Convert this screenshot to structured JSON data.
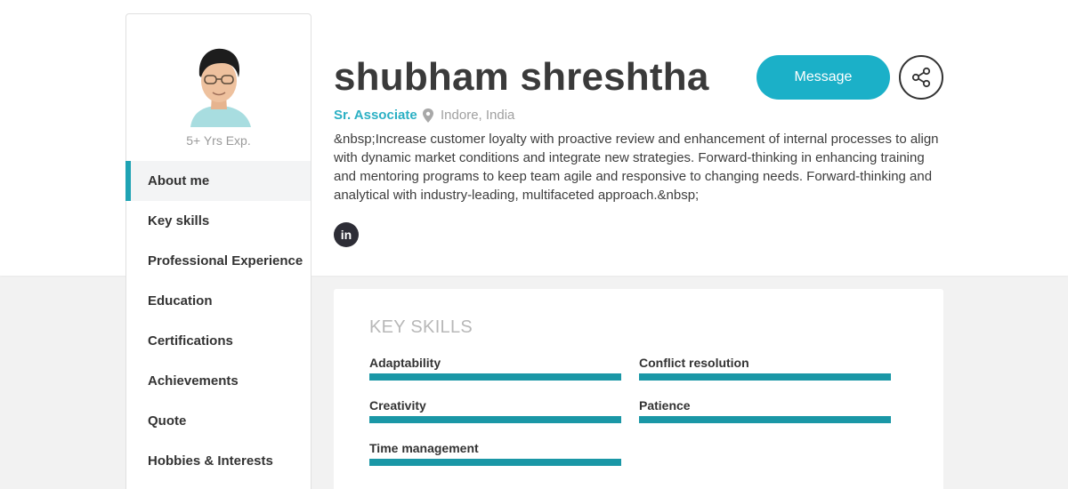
{
  "profile": {
    "name": "shubham shreshtha",
    "designation": "Sr. Associate",
    "location": "Indore, India",
    "experience": "5+ Yrs Exp.",
    "bio": "&nbsp;Increase customer loyalty with proactive review and enhancement of internal processes to align with dynamic market conditions and integrate new strategies. Forward-thinking in enhancing training and mentoring programs to keep team agile and responsive to changing needs. Forward-thinking and analytical with industry-leading, multifaceted approach.&nbsp;",
    "linkedin_label": "in"
  },
  "actions": {
    "message_label": "Message"
  },
  "sidebar": {
    "items": [
      {
        "label": "About me"
      },
      {
        "label": "Key skills"
      },
      {
        "label": "Professional Experience"
      },
      {
        "label": "Education"
      },
      {
        "label": "Certifications"
      },
      {
        "label": "Achievements"
      },
      {
        "label": "Quote"
      },
      {
        "label": "Hobbies & Interests"
      }
    ],
    "active_index": 0
  },
  "key_skills": {
    "title": "KEY SKILLS",
    "skills": [
      {
        "name": "Adaptability",
        "level": 1.0
      },
      {
        "name": "Conflict resolution",
        "level": 1.0
      },
      {
        "name": "Creativity",
        "level": 1.0
      },
      {
        "name": "Patience",
        "level": 1.0
      },
      {
        "name": "Time management",
        "level": 1.0
      }
    ]
  },
  "colors": {
    "accent": "#1bb0c8",
    "skill_bar": "#1a97a6",
    "name_text": "#3a3a3a"
  },
  "icons": {
    "location": "map-pin-icon",
    "share": "share-icon",
    "linkedin": "linkedin-icon"
  }
}
